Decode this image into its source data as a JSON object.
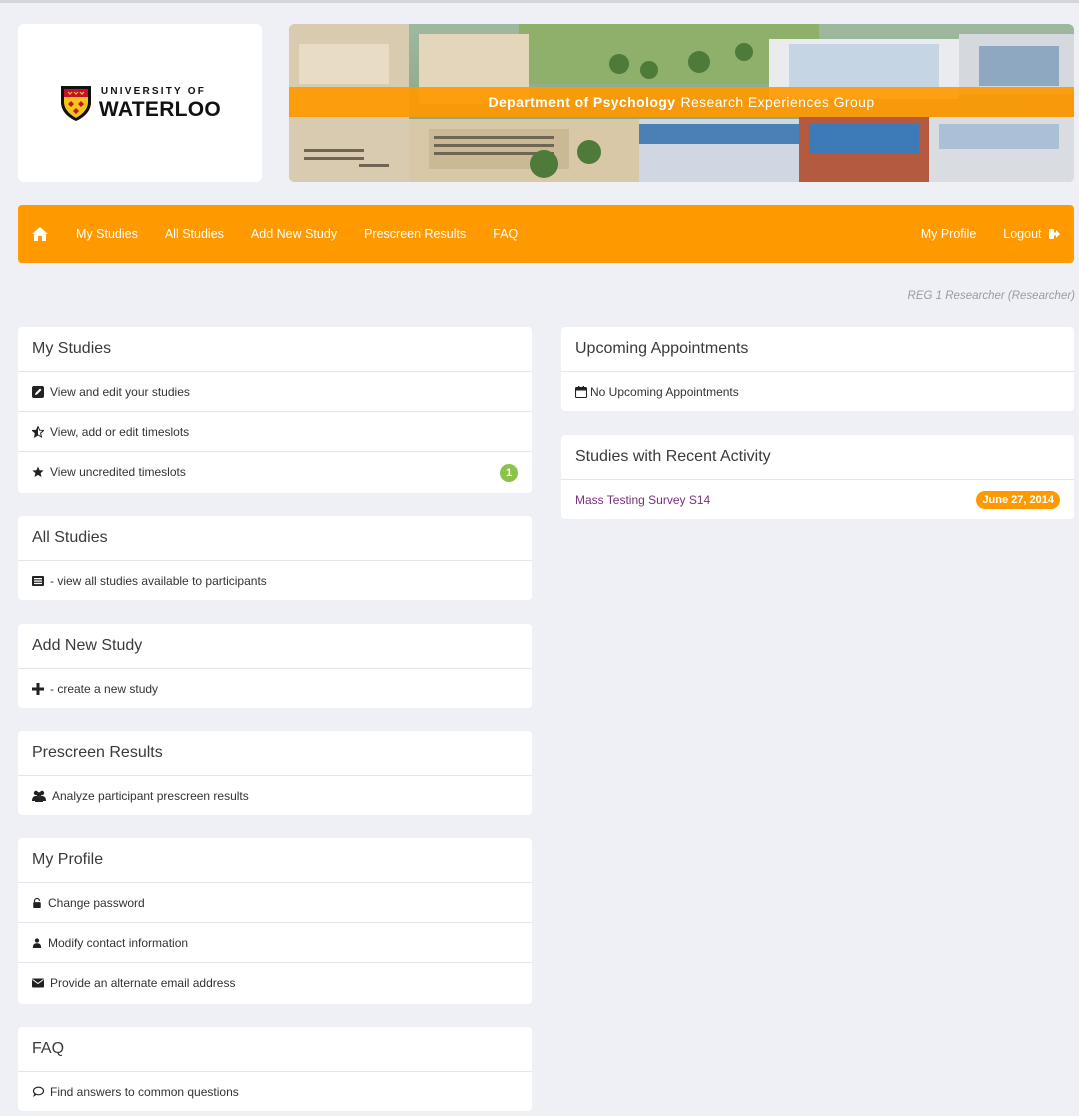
{
  "logo": {
    "line1": "UNIVERSITY OF",
    "line2": "WATERLOO"
  },
  "banner": {
    "bold_text": "Department of Psychology",
    "text": "Research Experiences Group"
  },
  "nav": {
    "home_icon": "home-icon",
    "items": [
      "My Studies",
      "All Studies",
      "Add New Study",
      "Prescreen Results",
      "FAQ"
    ],
    "right_items": [
      "My Profile",
      "Logout"
    ],
    "logout_icon": "logout-icon"
  },
  "user_line": "REG 1 Researcher (Researcher)",
  "panels": {
    "my_studies": {
      "title": "My Studies",
      "rows": [
        {
          "label": "View and edit your studies",
          "icon": "edit-icon"
        },
        {
          "label": "View, add or edit timeslots",
          "icon": "half-star-icon"
        },
        {
          "label": "View uncredited timeslots",
          "icon": "star-icon",
          "badge": "1"
        }
      ]
    },
    "all_studies": {
      "title": "All Studies",
      "rows": [
        {
          "label": "- view all studies available to participants",
          "icon": "list-icon"
        }
      ]
    },
    "add_new_study": {
      "title": "Add New Study",
      "rows": [
        {
          "label": "- create a new study",
          "icon": "plus-icon"
        }
      ]
    },
    "prescreen_results": {
      "title": "Prescreen Results",
      "rows": [
        {
          "label": "Analyze participant prescreen results",
          "icon": "users-icon"
        }
      ]
    },
    "my_profile": {
      "title": "My Profile",
      "rows": [
        {
          "label": "Change password",
          "icon": "lock-icon"
        },
        {
          "label": "Modify contact information",
          "icon": "user-icon"
        },
        {
          "label": "Provide an alternate email address",
          "icon": "envelope-icon"
        }
      ]
    },
    "faq": {
      "title": "FAQ",
      "rows": [
        {
          "label": "Find answers to common questions",
          "icon": "chat-icon"
        }
      ]
    },
    "upcoming": {
      "title": "Upcoming Appointments",
      "rows": [
        {
          "label": "No Upcoming Appointments",
          "icon": "calendar-icon"
        }
      ]
    },
    "recent": {
      "title": "Studies with Recent Activity",
      "rows": [
        {
          "label": "Mass Testing Survey S14",
          "date": "June 27, 2014"
        }
      ]
    }
  },
  "colors": {
    "accent": "#ff9900",
    "background": "#eff0f5",
    "badge_green": "#8bc34a",
    "link_purple": "#7b2f7d"
  }
}
